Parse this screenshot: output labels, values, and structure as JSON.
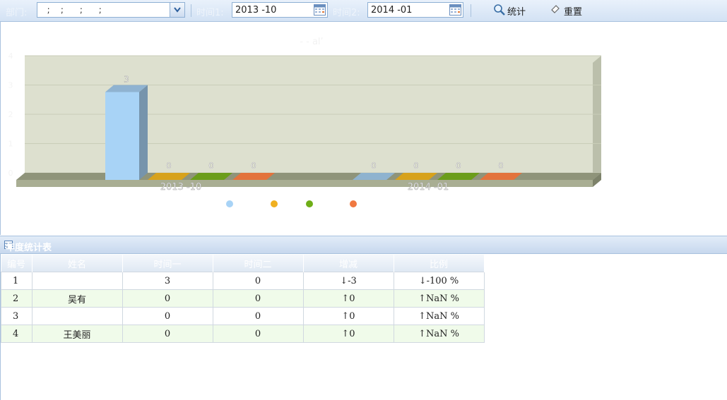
{
  "toolbar": {
    "dept_label": "部门:",
    "dept_value": "  ;    ;      ;      ;",
    "time1_label": "时间1:",
    "time1_value": "2013 -10",
    "time2_label": "时间2:",
    "time2_value": "2014 -01",
    "stat_label": "统计",
    "reset_label": "重置"
  },
  "chart": {
    "title": "- - al’",
    "y_ticks": [
      "4",
      "3",
      "2",
      "1",
      "0",
      "0"
    ],
    "bars": [
      {
        "group": 0,
        "label": "3",
        "color": "#a8d3f6"
      },
      {
        "group": 0,
        "label": "0",
        "color": "#d7a21c"
      },
      {
        "group": 0,
        "label": "0",
        "color": "#6b9d1a"
      },
      {
        "group": 0,
        "label": "0",
        "color": "#e3733c"
      },
      {
        "group": 1,
        "label": "0",
        "color": "#8fb3cf"
      },
      {
        "group": 1,
        "label": "0",
        "color": "#d7a21c"
      },
      {
        "group": 1,
        "label": "0",
        "color": "#6b9d1a"
      },
      {
        "group": 1,
        "label": "0",
        "color": "#e3733c"
      }
    ],
    "categories": [
      "2013 -10",
      "2014 -01"
    ],
    "legend_colors": [
      "#a8d3f6",
      "#f0b020",
      "#6fae17",
      "#f07840"
    ]
  },
  "chart_data": {
    "type": "bar",
    "categories": [
      "2013 -10",
      "2014 -01"
    ],
    "series": [
      {
        "values": [
          3,
          0
        ]
      },
      {
        "values": [
          0,
          0
        ]
      },
      {
        "values": [
          0,
          0
        ]
      },
      {
        "values": [
          0,
          0
        ]
      }
    ],
    "ylim": [
      0,
      4
    ]
  },
  "grid": {
    "title": "年度统计表",
    "columns": [
      "编号",
      "姓名",
      "时间一",
      "时间二",
      "增减",
      "比例"
    ],
    "rows": [
      {
        "no": "1",
        "name": "",
        "t1": "3",
        "t2": "0",
        "delta": "↓-3",
        "ratio": "↓-100 %"
      },
      {
        "no": "2",
        "name": "吴有",
        "t1": "0",
        "t2": "0",
        "delta": "↑0",
        "ratio": "↑NaN %"
      },
      {
        "no": "3",
        "name": "",
        "t1": "0",
        "t2": "0",
        "delta": "↑0",
        "ratio": "↑NaN %"
      },
      {
        "no": "4",
        "name": "王美丽",
        "t1": "0",
        "t2": "0",
        "delta": "↑0",
        "ratio": "↑NaN %"
      }
    ]
  }
}
